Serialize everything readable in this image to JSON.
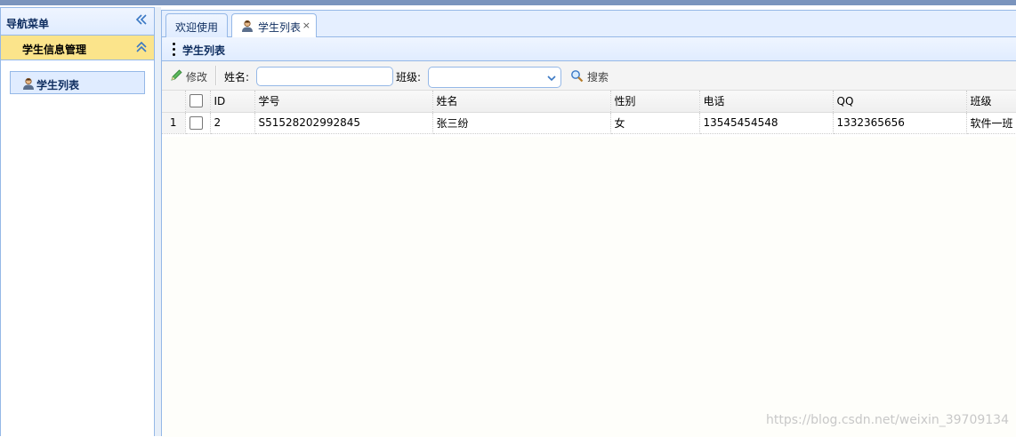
{
  "nav": {
    "title": "导航菜单",
    "group_title": "学生信息管理",
    "items": [
      {
        "label": "学生列表",
        "icon": "user-icon"
      }
    ]
  },
  "tabs": [
    {
      "label": "欢迎使用",
      "active": false
    },
    {
      "label": "学生列表",
      "active": true,
      "icon": "user-icon",
      "close": "×"
    }
  ],
  "panel": {
    "title": "学生列表"
  },
  "toolbar": {
    "edit_label": "修改",
    "name_label": "姓名:",
    "name_value": "",
    "class_label": "班级:",
    "class_value": "",
    "search_label": "搜索"
  },
  "grid": {
    "columns": [
      "ID",
      "学号",
      "姓名",
      "性别",
      "电话",
      "QQ",
      "班级"
    ],
    "rows": [
      {
        "rownum": "1",
        "cells": [
          "2",
          "S51528202992845",
          "张三纷",
          "女",
          "13545454548",
          "1332365656",
          "软件一班"
        ]
      }
    ]
  },
  "watermark": "https://blog.csdn.net/weixin_39709134",
  "colors": {
    "accent_border": "#95b8e7",
    "group_header": "#fbe48b",
    "top_bar": "#7a94bd"
  }
}
